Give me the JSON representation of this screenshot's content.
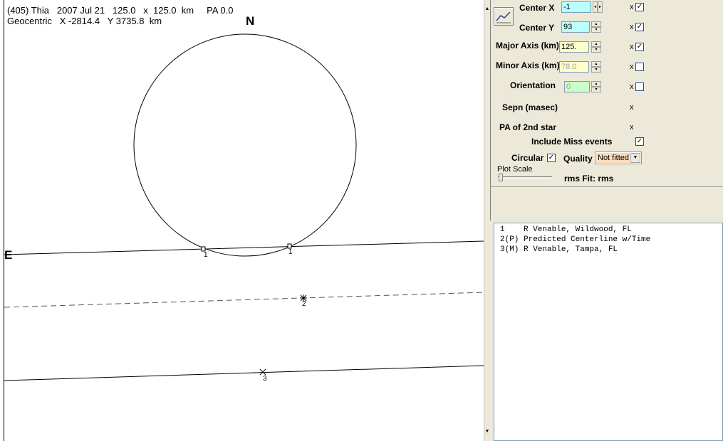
{
  "plot": {
    "header_line1": "(405) Thia   2007 Jul 21   125.0   x  125.0  km     PA 0.0",
    "header_line2": "Geocentric   X -2814.4   Y 3735.8  km",
    "north_label": "N",
    "east_label": "E",
    "chords": [
      {
        "label": "1"
      },
      {
        "label": "2"
      },
      {
        "label": "3"
      }
    ]
  },
  "controls": {
    "plot_button_icon": "chart-line-icon",
    "center_x_label": "Center X",
    "center_x_value": "-1",
    "center_y_label": "Center Y",
    "center_y_value": "93",
    "major_axis_label": "Major Axis (km)",
    "major_axis_value": "125.",
    "minor_axis_label": "Minor Axis (km)",
    "minor_axis_value": "78.0",
    "orientation_label": "Orientation",
    "orientation_value": "0",
    "sepn_label": "Sepn (masec)",
    "pa2nd_label": "PA of 2nd star",
    "x_mark": "x",
    "include_miss_label": "Include Miss events",
    "circular_label": "Circular",
    "quality_label": "Quality",
    "quality_value": "Not fitted",
    "plot_scale_label": "Plot Scale",
    "rms_fit_label": "rms Fit: rms",
    "fit_flags": {
      "center_x": true,
      "center_y": true,
      "major_axis": true,
      "minor_axis": false,
      "orientation": false
    },
    "include_miss_checked": true,
    "circular_checked": true
  },
  "observers": [
    "1    R Venable, Wildwood, FL",
    "2(P) Predicted Centerline w/Time",
    "3(M) R Venable, Tampa, FL"
  ],
  "colors": {
    "center_field": "#b9ffff",
    "axis_field": "#ffffcc",
    "orientation_field": "#c9ffc9",
    "quality_field": "#ffdcb9"
  }
}
